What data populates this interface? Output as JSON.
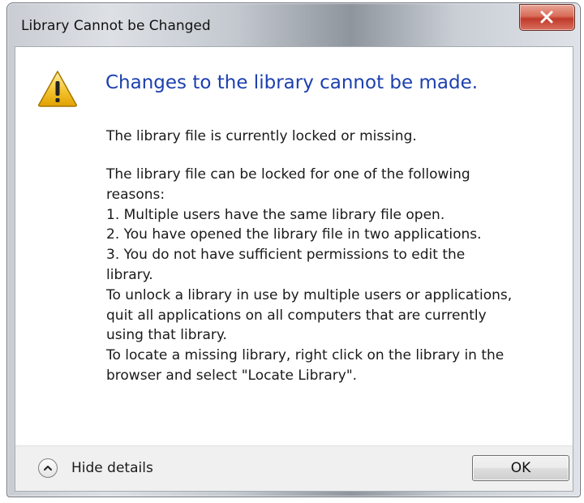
{
  "window": {
    "title": "Library Cannot be Changed"
  },
  "icons": {
    "close": "close-icon",
    "warning": "warning-icon",
    "chevron": "chevron-up-icon"
  },
  "dialog": {
    "main_instruction": "Changes to the library cannot be made.",
    "content": "The library file is currently locked or missing.",
    "details": [
      "The library file can be locked for one of the following",
      "reasons:",
      "1. Multiple users have the same library file open.",
      "2. You have opened the library file in two applications.",
      "3. You do not have sufficient permissions to edit the",
      "library.",
      "To unlock a library in use by multiple users or applications,",
      "quit all applications on all computers that are currently",
      "using that library.",
      "To locate a missing library, right click on the library in the",
      "browser and select \"Locate Library\"."
    ]
  },
  "footer": {
    "toggle_label": "Hide details",
    "ok_label": "OK"
  },
  "colors": {
    "instruction_blue": "#1c3fb0",
    "close_red": "#c0392b",
    "warning_yellow": "#f4c430"
  }
}
